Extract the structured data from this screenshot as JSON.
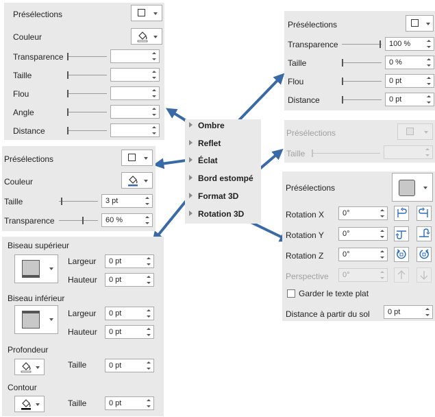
{
  "shadow_panel": {
    "presets_label": "Présélections",
    "color_label": "Couleur",
    "transparency_label": "Transparence",
    "size_label": "Taille",
    "blur_label": "Flou",
    "angle_label": "Angle",
    "distance_label": "Distance",
    "transparency_value": "",
    "size_value": "",
    "blur_value": "",
    "angle_value": "",
    "distance_value": ""
  },
  "reflection_panel": {
    "presets_label": "Présélections",
    "transparency_label": "Transparence",
    "size_label": "Taille",
    "blur_label": "Flou",
    "distance_label": "Distance",
    "transparency_value": "100 %",
    "size_value": "0 %",
    "blur_value": "0 pt",
    "distance_value": "0 pt"
  },
  "glow_panel": {
    "presets_label": "Présélections",
    "color_label": "Couleur",
    "size_label": "Taille",
    "transparency_label": "Transparence",
    "size_value": "3 pt",
    "transparency_value": "60 %",
    "color": "#3a6aa6"
  },
  "soft_edges_panel": {
    "presets_label": "Présélections",
    "size_label": "Taille"
  },
  "format3d_panel": {
    "top_bevel_label": "Biseau supérieur",
    "bottom_bevel_label": "Biseau inférieur",
    "width_label": "Largeur",
    "height_label": "Hauteur",
    "top_width_value": "0 pt",
    "top_height_value": "0 pt",
    "bottom_width_value": "0 pt",
    "bottom_height_value": "0 pt",
    "depth_label": "Profondeur",
    "depth_size_label": "Taille",
    "depth_size_value": "0 pt",
    "contour_label": "Contour",
    "contour_size_label": "Taille",
    "contour_size_value": "0 pt"
  },
  "rotation3d_panel": {
    "presets_label": "Présélections",
    "rotation_x_label": "Rotation X",
    "rotation_y_label": "Rotation Y",
    "rotation_z_label": "Rotation Z",
    "perspective_label": "Perspective",
    "rotation_x_value": "0°",
    "rotation_y_value": "0°",
    "rotation_z_value": "0°",
    "perspective_value": "0°",
    "keep_text_flat_label": "Garder le texte plat",
    "keep_text_flat_checked": false,
    "distance_label": "Distance à partir du sol",
    "distance_value": "0 pt"
  },
  "effects_menu": {
    "items": [
      "Ombre",
      "Reflet",
      "Éclat",
      "Bord estompé",
      "Format 3D",
      "Rotation 3D"
    ]
  },
  "colors": {
    "panel_bg": "#e9e9e9",
    "arrow": "#3a6aa6"
  }
}
